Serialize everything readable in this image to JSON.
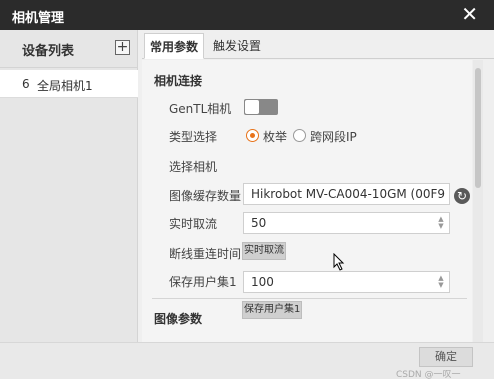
{
  "window": {
    "title": "相机管理",
    "close": "✕"
  },
  "sidebar": {
    "header": "设备列表",
    "add": "+",
    "items": [
      {
        "num": "6",
        "name": "全局相机1"
      }
    ]
  },
  "tabs": [
    {
      "label": "常用参数",
      "active": true
    },
    {
      "label": "触发设置",
      "active": false
    }
  ],
  "camera_connection": {
    "title": "相机连接",
    "gentl": {
      "label": "GenTL相机",
      "enabled": false
    },
    "type_select": {
      "label": "类型选择",
      "options": [
        {
          "label": "枚举",
          "checked": true
        },
        {
          "label": "跨网段IP",
          "checked": false
        }
      ]
    },
    "select_camera": {
      "label": "选择相机",
      "value": "Hikrobot MV-CA004-10GM (00F9"
    },
    "buffer": {
      "label": "图像缓存数量",
      "value": "50"
    },
    "realtime": {
      "label": "实时取流",
      "button": "实时取流"
    },
    "reconnect": {
      "label": "断线重连时间",
      "value": "100"
    },
    "save_user_set": {
      "label": "保存用户集1",
      "button": "保存用户集1"
    }
  },
  "image_params": {
    "title": "图像参数"
  },
  "footer": {
    "ok": "确定",
    "watermark": "CSDN @一叹一"
  },
  "colors": {
    "accent": "#e8731a",
    "titlebar": "#2b2b2b"
  }
}
